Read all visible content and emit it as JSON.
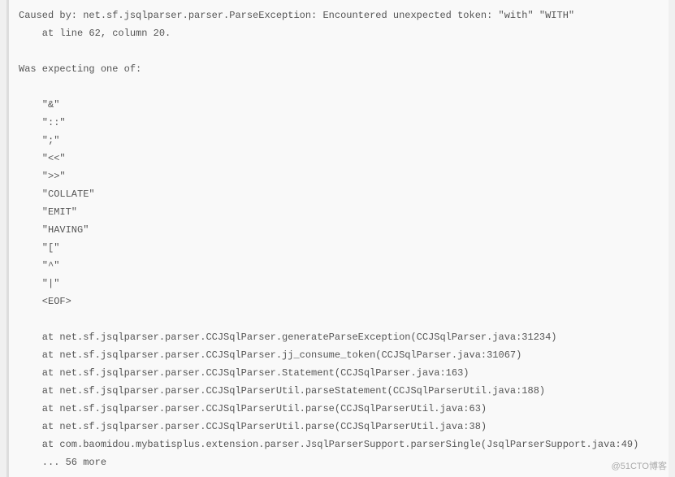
{
  "stacktrace": {
    "lines": [
      "Caused by: net.sf.jsqlparser.parser.ParseException: Encountered unexpected token: \"with\" \"WITH\"",
      "    at line 62, column 20.",
      "",
      "Was expecting one of:",
      "",
      "    \"&\"",
      "    \"::\"",
      "    \";\"",
      "    \"<<\"",
      "    \">>\"",
      "    \"COLLATE\"",
      "    \"EMIT\"",
      "    \"HAVING\"",
      "    \"[\"",
      "    \"^\"",
      "    \"|\"",
      "    <EOF>",
      "",
      "    at net.sf.jsqlparser.parser.CCJSqlParser.generateParseException(CCJSqlParser.java:31234)",
      "    at net.sf.jsqlparser.parser.CCJSqlParser.jj_consume_token(CCJSqlParser.java:31067)",
      "    at net.sf.jsqlparser.parser.CCJSqlParser.Statement(CCJSqlParser.java:163)",
      "    at net.sf.jsqlparser.parser.CCJSqlParserUtil.parseStatement(CCJSqlParserUtil.java:188)",
      "    at net.sf.jsqlparser.parser.CCJSqlParserUtil.parse(CCJSqlParserUtil.java:63)",
      "    at net.sf.jsqlparser.parser.CCJSqlParserUtil.parse(CCJSqlParserUtil.java:38)",
      "    at com.baomidou.mybatisplus.extension.parser.JsqlParserSupport.parserSingle(JsqlParserSupport.java:49)",
      "    ... 56 more"
    ]
  },
  "watermark": "@51CTO博客"
}
